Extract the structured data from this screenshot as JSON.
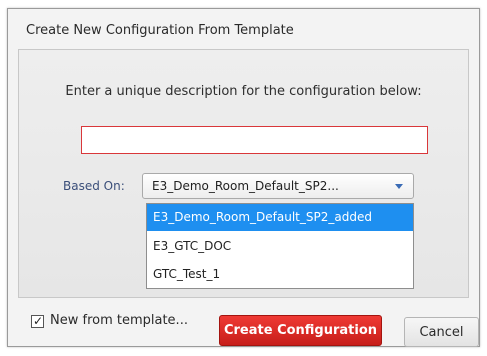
{
  "dialog": {
    "title": "Create New Configuration From Template",
    "instructions": "Enter a unique description for the configuration below:",
    "description_value": "",
    "based_on_label": "Based On:",
    "based_on_selected": "E3_Demo_Room_Default_SP2...",
    "dropdown_options": [
      "E3_Demo_Room_Default_SP2_added",
      "E3_GTC_DOC",
      "GTC_Test_1"
    ],
    "checkbox_label": "New from template...",
    "checkbox_checked": true,
    "create_label": "Create Configuration",
    "cancel_label": "Cancel"
  },
  "icons": {
    "dropdown": "chevron-down-icon",
    "check": "checkmark-icon"
  },
  "colors": {
    "create_button": "#d42a24",
    "highlight": "#1e8ff0",
    "input_border": "#d9373a",
    "label_blue": "#3b4f7a"
  }
}
